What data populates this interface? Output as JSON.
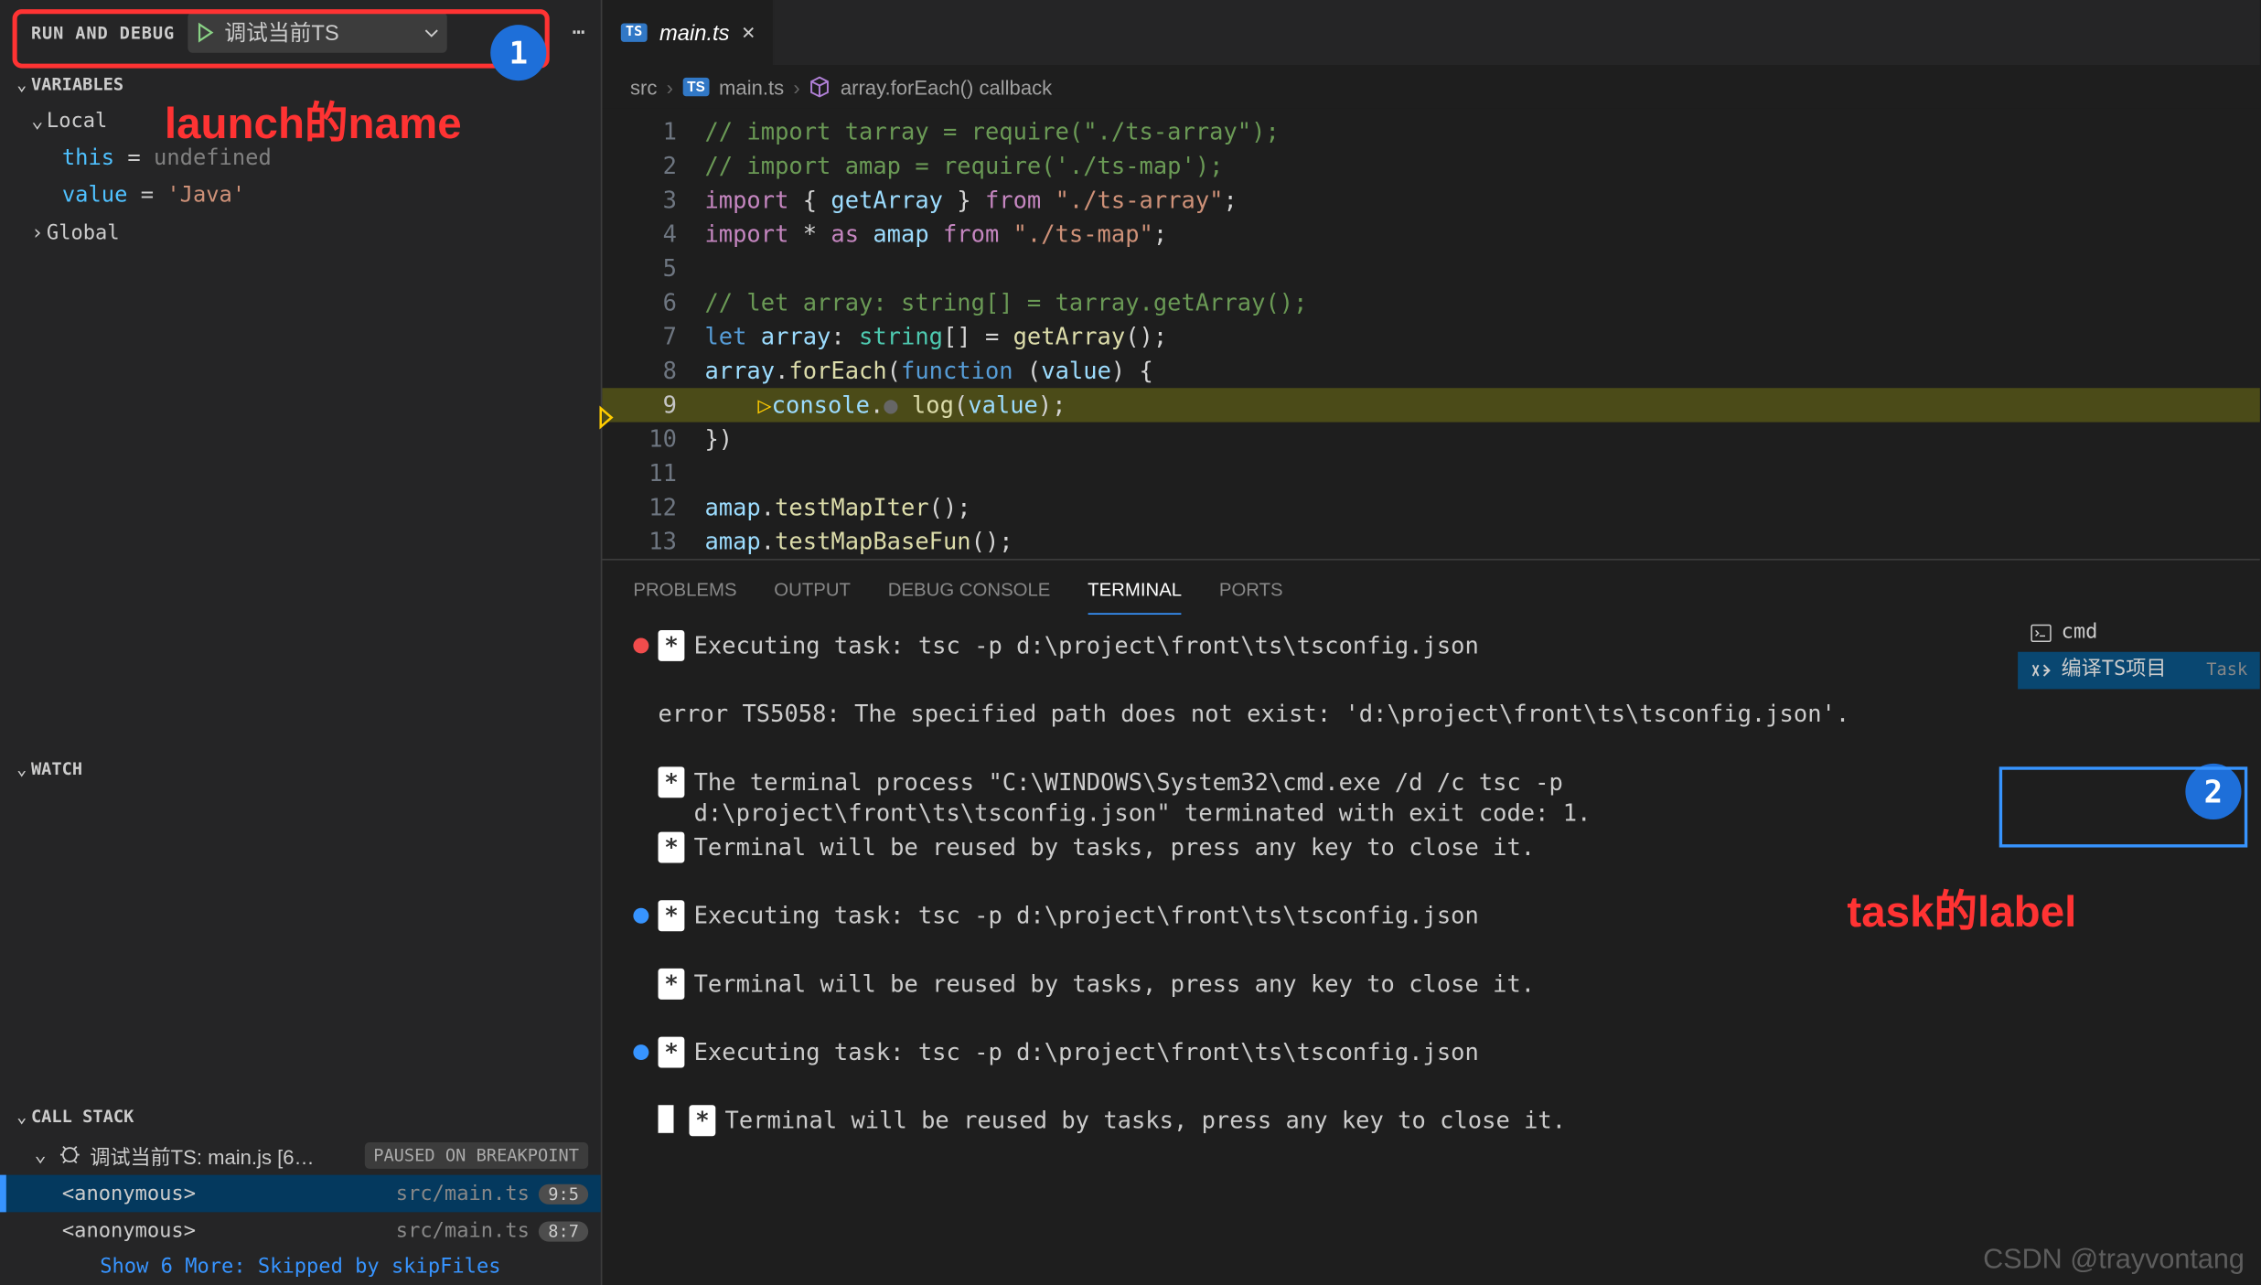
{
  "header": {
    "title": "RUN AND DEBUG",
    "config_name": "调试当前TS"
  },
  "annotations": {
    "anno1": "launch的name",
    "anno2": "task的label",
    "badge1": "1",
    "badge2": "2"
  },
  "variables": {
    "title": "VARIABLES",
    "scopes": [
      {
        "name": "Local",
        "expanded": true,
        "vars": [
          {
            "name": "this",
            "eq": " = ",
            "valueClass": "var-val-undef",
            "value": "undefined"
          },
          {
            "name": "value",
            "eq": " = ",
            "valueClass": "var-val-str",
            "value": "'Java'"
          }
        ]
      },
      {
        "name": "Global",
        "expanded": false,
        "vars": []
      }
    ]
  },
  "watch": {
    "title": "WATCH"
  },
  "callstack": {
    "title": "CALL STACK",
    "thread": "调试当前TS: main.js [6…",
    "state": "PAUSED ON BREAKPOINT",
    "frames": [
      {
        "name": "<anonymous>",
        "loc": "src/main.ts",
        "lc": "9:5"
      },
      {
        "name": "<anonymous>",
        "loc": "src/main.ts",
        "lc": "8:7"
      }
    ],
    "more": "Show 6 More: Skipped by skipFiles"
  },
  "tab": {
    "label": "main.ts"
  },
  "breadcrumb": {
    "src": "src",
    "file": "main.ts",
    "symbol": "array.forEach() callback"
  },
  "code": [
    {
      "n": 1,
      "html": "<span class='c-comment'>// import tarray = require(\"./ts-array\");</span>"
    },
    {
      "n": 2,
      "html": "<span class='c-comment'>// import amap = require('./ts-map');</span>"
    },
    {
      "n": 3,
      "html": "<span class='c-kw'>import</span> <span class='c-punc'>{ </span><span class='c-var'>getArray</span><span class='c-punc'> }</span> <span class='c-kw'>from</span> <span class='c-str'>\"./ts-array\"</span><span class='c-punc'>;</span>"
    },
    {
      "n": 4,
      "html": "<span class='c-kw'>import</span> <span class='c-punc'>*</span> <span class='c-kw'>as</span> <span class='c-var'>amap</span> <span class='c-kw'>from</span> <span class='c-str'>\"./ts-map\"</span><span class='c-punc'>;</span>"
    },
    {
      "n": 5,
      "html": ""
    },
    {
      "n": 6,
      "html": "<span class='c-comment'>// let array: string[] = tarray.getArray();</span>"
    },
    {
      "n": 7,
      "html": "<span class='c-kw2'>let</span> <span class='c-var'>array</span><span class='c-punc'>:</span> <span class='c-type'>string</span><span class='c-punc'>[] =</span> <span class='c-fn'>getArray</span><span class='c-punc'>();</span>"
    },
    {
      "n": 8,
      "html": "<span class='c-var'>array</span><span class='c-punc'>.</span><span class='c-fn'>forEach</span><span class='c-punc'>(</span><span class='c-kw2'>function</span> <span class='c-punc'>(</span><span class='c-var'>value</span><span class='c-punc'>) {</span>"
    },
    {
      "n": 9,
      "current": true,
      "html": "    <span class='exec-ptr'>▷</span><span class='c-var'>console</span><span class='c-punc'>.</span><span class='dim-dot'>●</span> <span class='c-fn'>log</span><span class='c-punc'>(</span><span class='c-var'>value</span><span class='c-punc'>);</span>"
    },
    {
      "n": 10,
      "html": "<span class='c-punc'>})</span>"
    },
    {
      "n": 11,
      "html": ""
    },
    {
      "n": 12,
      "html": "<span class='c-var'>amap</span><span class='c-punc'>.</span><span class='c-fn'>testMapIter</span><span class='c-punc'>();</span>"
    },
    {
      "n": 13,
      "html": "<span class='c-var'>amap</span><span class='c-punc'>.</span><span class='c-fn'>testMapBaseFun</span><span class='c-punc'>();</span>"
    }
  ],
  "panel": {
    "tabs": [
      "PROBLEMS",
      "OUTPUT",
      "DEBUG CONSOLE",
      "TERMINAL",
      "PORTS"
    ],
    "active": 3,
    "terminal": [
      {
        "dot": "red",
        "badge": "*",
        "text": "Executing task: tsc -p d:\\project\\front\\ts\\tsconfig.json "
      },
      {
        "text": ""
      },
      {
        "text": "error TS5058: The specified path does not exist: 'd:\\project\\front\\ts\\tsconfig.json'."
      },
      {
        "text": ""
      },
      {
        "badge": "*",
        "text": "The terminal process \"C:\\WINDOWS\\System32\\cmd.exe /d /c tsc -p d:\\project\\front\\ts\\tsconfig.json\" terminated with exit code: 1.",
        "wrap": true
      },
      {
        "badge": "*",
        "text": "Terminal will be reused by tasks, press any key to close it."
      },
      {
        "text": ""
      },
      {
        "dot": "blue",
        "badge": "*",
        "text": "Executing task: tsc -p d:\\project\\front\\ts\\tsconfig.json "
      },
      {
        "text": ""
      },
      {
        "badge": "*",
        "text": "Terminal will be reused by tasks, press any key to close it."
      },
      {
        "text": ""
      },
      {
        "dot": "blue",
        "badge": "*",
        "text": "Executing task: tsc -p d:\\project\\front\\ts\\tsconfig.json "
      },
      {
        "text": ""
      },
      {
        "cursor": true,
        "badge": "*",
        "text": "Terminal will be reused by tasks, press any key to close it."
      }
    ],
    "term_list": [
      {
        "icon": "cmd",
        "label": "cmd",
        "suffix": ""
      },
      {
        "icon": "tools",
        "label": "编译TS项目",
        "suffix": "Task",
        "selected": true
      }
    ]
  },
  "watermark": "CSDN @trayvontang"
}
